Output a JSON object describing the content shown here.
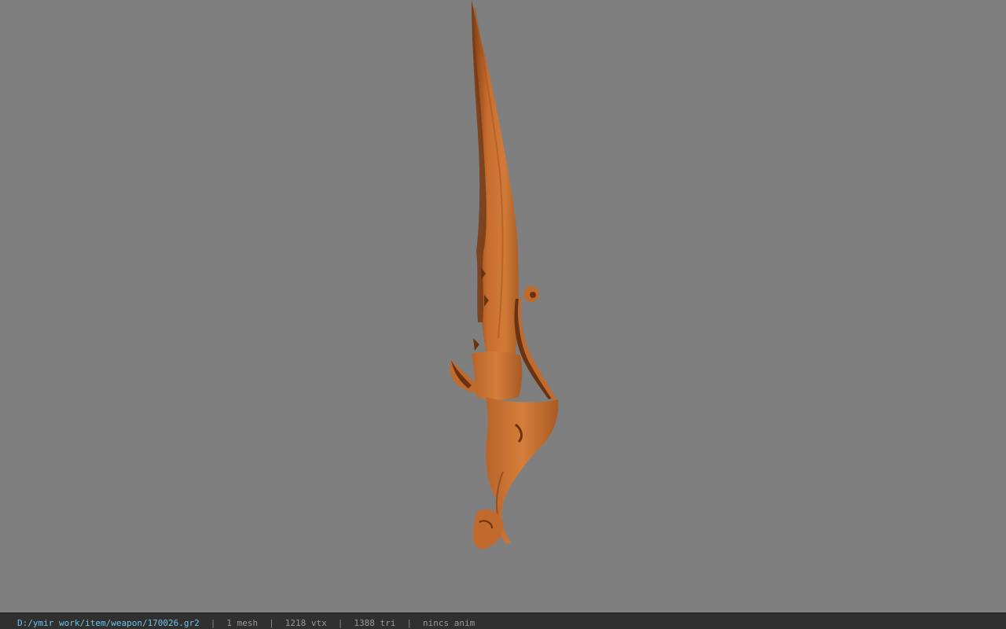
{
  "viewer": {
    "background_color": "#7f7f7f",
    "model_color": "#c06a2e",
    "model_shadow_color": "#6a3210",
    "model": "curved-sword"
  },
  "status": {
    "file_path": "D:/ymir work/item/weapon/170026.gr2",
    "mesh": "1 mesh",
    "vertices": "1218 vtx",
    "triangles": "1388 tri",
    "anim": "nincs anim",
    "separator": "|"
  }
}
